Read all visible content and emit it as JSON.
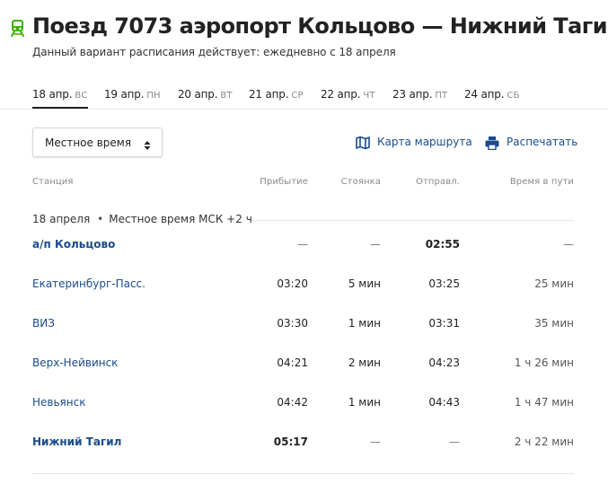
{
  "header": {
    "title": "Поезд 7073 аэропорт Кольцово — Нижний Тагил",
    "subtitle": "Данный вариант расписания действует: ежедневно с 18 апреля",
    "icon": "train-icon",
    "icon_color": "#3cb400"
  },
  "tabs": [
    {
      "date": "18 апр.",
      "weekday": "ВС",
      "active": true
    },
    {
      "date": "19 апр.",
      "weekday": "ПН",
      "active": false
    },
    {
      "date": "20 апр.",
      "weekday": "ВТ",
      "active": false
    },
    {
      "date": "21 апр.",
      "weekday": "СР",
      "active": false
    },
    {
      "date": "22 апр.",
      "weekday": "ЧТ",
      "active": false
    },
    {
      "date": "23 апр.",
      "weekday": "ПТ",
      "active": false
    },
    {
      "date": "24 апр.",
      "weekday": "СБ",
      "active": false
    }
  ],
  "controls": {
    "time_select_value": "Местное время",
    "route_map_label": "Карта маршрута",
    "print_label": "Распечатать",
    "link_color": "#1a4b8c"
  },
  "table": {
    "columns": {
      "station": "Станция",
      "arrival": "Прибытие",
      "stop": "Стоянка",
      "departure": "Отправл.",
      "travel": "Время в пути"
    },
    "date_note": {
      "date": "18 апреля",
      "separator": "•",
      "tz": "Местное время МСК +2 ч"
    },
    "rows": [
      {
        "station": "а/п Кольцово",
        "arrival": "—",
        "stop": "—",
        "departure": "02:55",
        "travel": "—"
      },
      {
        "station": "Екатеринбург-Пасс.",
        "arrival": "03:20",
        "stop": "5 мин",
        "departure": "03:25",
        "travel": "25 мин"
      },
      {
        "station": "ВИЗ",
        "arrival": "03:30",
        "stop": "1 мин",
        "departure": "03:31",
        "travel": "35 мин"
      },
      {
        "station": "Верх-Нейвинск",
        "arrival": "04:21",
        "stop": "2 мин",
        "departure": "04:23",
        "travel": "1 ч 26 мин"
      },
      {
        "station": "Невьянск",
        "arrival": "04:42",
        "stop": "1 мин",
        "departure": "04:43",
        "travel": "1 ч 47 мин"
      },
      {
        "station": "Нижний Тагил",
        "arrival": "05:17",
        "stop": "—",
        "departure": "—",
        "travel": "2 ч 22 мин"
      }
    ]
  }
}
